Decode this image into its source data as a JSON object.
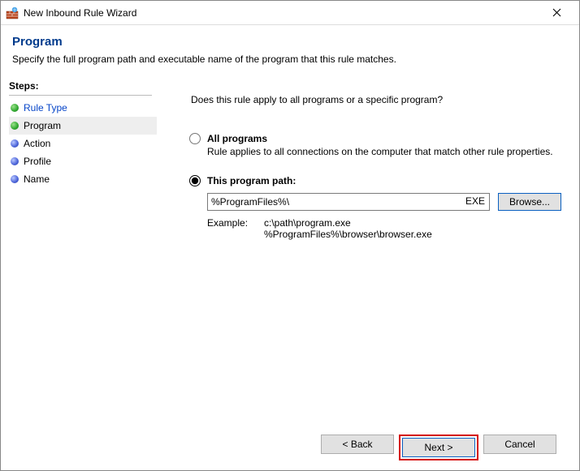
{
  "window": {
    "title": "New Inbound Rule Wizard"
  },
  "header": {
    "title": "Program",
    "subtitle": "Specify the full program path and executable name of the program that this rule matches."
  },
  "sidebar": {
    "steps_label": "Steps:",
    "items": [
      {
        "label": "Rule Type",
        "state": "link"
      },
      {
        "label": "Program",
        "state": "current"
      },
      {
        "label": "Action",
        "state": "future"
      },
      {
        "label": "Profile",
        "state": "future"
      },
      {
        "label": "Name",
        "state": "future"
      }
    ]
  },
  "main": {
    "question": "Does this rule apply to all programs or a specific program?",
    "option_all": {
      "label": "All programs",
      "desc": "Rule applies to all connections on the computer that match other rule properties.",
      "selected": false
    },
    "option_path": {
      "label": "This program path:",
      "selected": true,
      "value": "%ProgramFiles%\\",
      "ext_hint": "EXE",
      "browse": "Browse..."
    },
    "example": {
      "label": "Example:",
      "paths": "c:\\path\\program.exe\n%ProgramFiles%\\browser\\browser.exe"
    }
  },
  "footer": {
    "back": "< Back",
    "next": "Next >",
    "cancel": "Cancel"
  }
}
